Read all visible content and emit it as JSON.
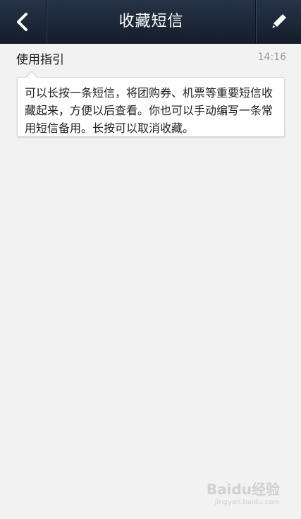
{
  "titlebar": {
    "title": "收藏短信",
    "back_icon": "chevron-left-icon",
    "edit_icon": "pencil-icon"
  },
  "messages": [
    {
      "sender": "使用指引",
      "time": "14:16",
      "body": "可以长按一条短信，将团购券、机票等重要短信收藏起来，方便以后查看。你也可以手动编写一条常用短信备用。长按可以取消收藏。"
    }
  ],
  "watermark": {
    "brand": "Baidu经验",
    "url": "jingyan.baidu.com"
  },
  "colors": {
    "titlebar_bg": "#1c2638",
    "page_bg": "#f2f2f2",
    "bubble_bg": "#ffffff"
  }
}
